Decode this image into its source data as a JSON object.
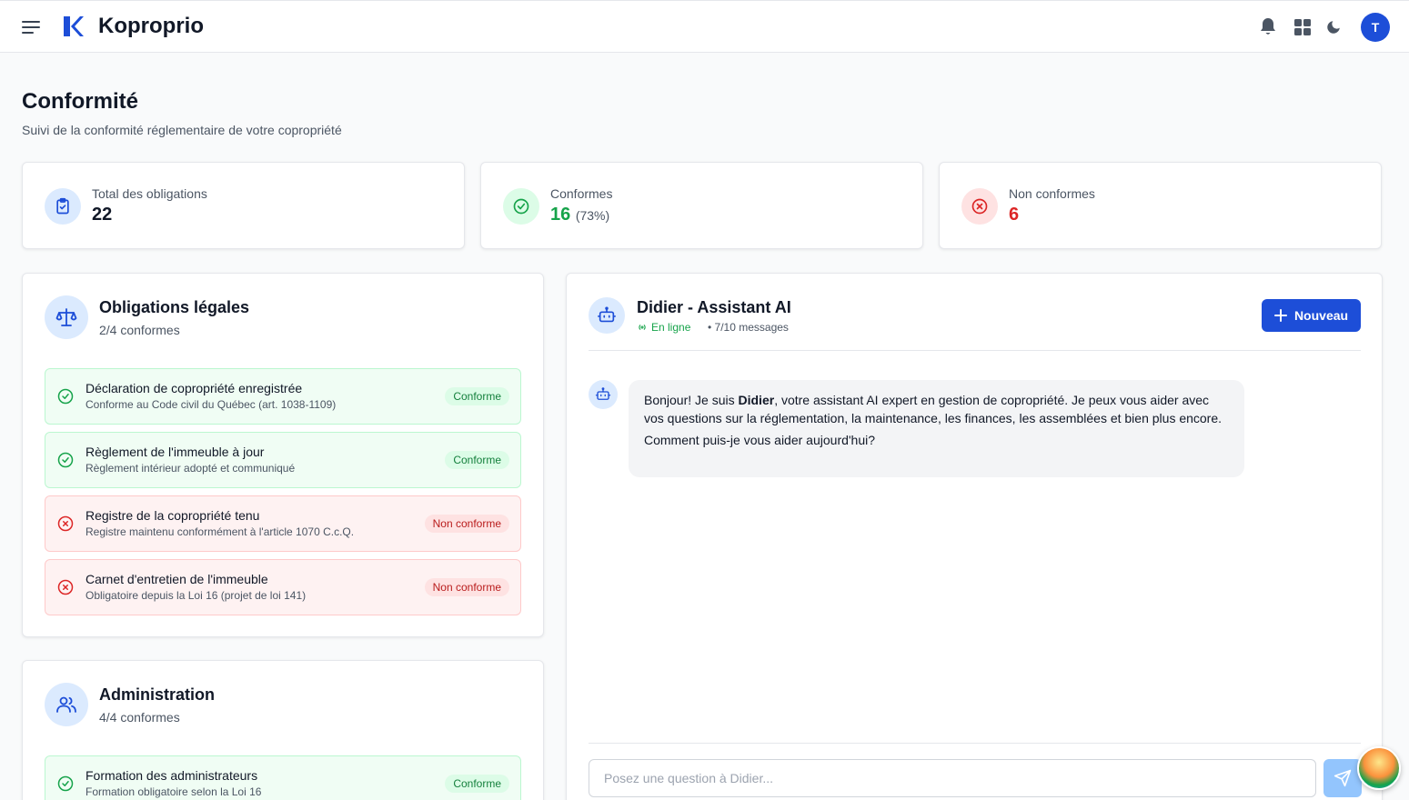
{
  "app": {
    "name": "Koproprio",
    "user_initial": "T"
  },
  "page": {
    "title": "Conformité",
    "subtitle": "Suivi de la conformité réglementaire de votre copropriété"
  },
  "stats": [
    {
      "label": "Total des obligations",
      "value": "22",
      "extra": "",
      "color": "#111827",
      "icon": "clipboard-check-icon"
    },
    {
      "label": "Conformes",
      "value": "16",
      "extra": "(73%)",
      "color": "#16a34a",
      "icon": "check-circle-icon"
    },
    {
      "label": "Non conformes",
      "value": "6",
      "extra": "",
      "color": "#dc2626",
      "icon": "x-circle-icon"
    }
  ],
  "sections": [
    {
      "title": "Obligations légales",
      "summary": "2/4 conformes",
      "icon": "scale-icon",
      "items": [
        {
          "title": "Déclaration de copropriété enregistrée",
          "desc": "Conforme au Code civil du Québec (art. 1038-1109)",
          "status": "Conforme"
        },
        {
          "title": "Règlement de l'immeuble à jour",
          "desc": "Règlement intérieur adopté et communiqué",
          "status": "Conforme"
        },
        {
          "title": "Registre de la copropriété tenu",
          "desc": "Registre maintenu conformément à l'article 1070 C.c.Q.",
          "status": "Non conforme"
        },
        {
          "title": "Carnet d'entretien de l'immeuble",
          "desc": "Obligatoire depuis la Loi 16 (projet de loi 141)",
          "status": "Non conforme"
        }
      ]
    },
    {
      "title": "Administration",
      "summary": "4/4 conformes",
      "icon": "users-icon",
      "items": [
        {
          "title": "Formation des administrateurs",
          "desc": "Formation obligatoire selon la Loi 16",
          "status": "Conforme"
        }
      ]
    }
  ],
  "chat": {
    "title": "Didier - Assistant AI",
    "online": "En ligne",
    "count": "• 7/10 messages",
    "new_label": "Nouveau",
    "message": {
      "pre": "Bonjour! Je suis ",
      "bold": "Didier",
      "post": ", votre assistant AI expert en gestion de copropriété. Je peux vous aider avec vos questions sur la réglementation, la maintenance, les finances, les assemblées et bien plus encore.",
      "line2": "Comment puis-je vous aider aujourd'hui?"
    },
    "input_placeholder": "Posez une question à Didier..."
  },
  "colors": {
    "accent": "#1d4ed8",
    "ok": "#16a34a",
    "ko": "#dc2626"
  }
}
